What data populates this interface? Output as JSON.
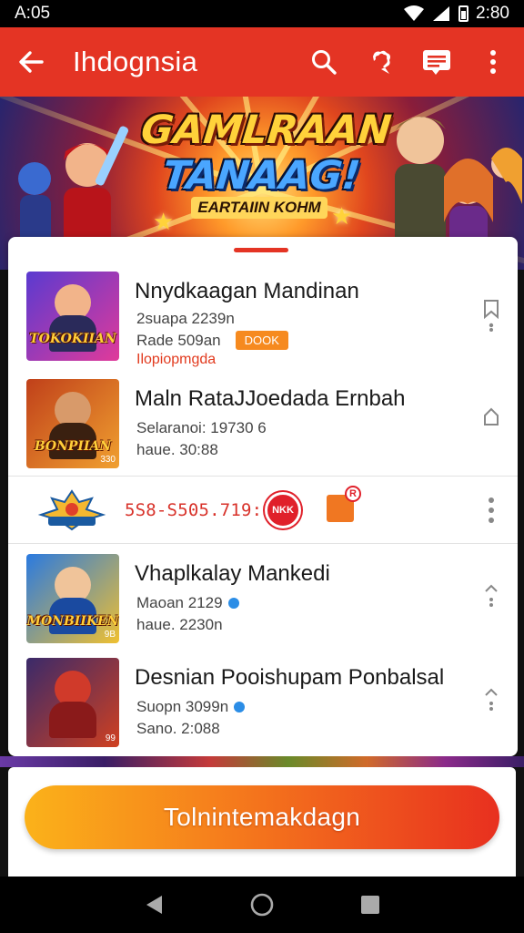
{
  "status_bar": {
    "time": "A:05",
    "clock": "2:80"
  },
  "app_bar": {
    "title": "Ihdognsia"
  },
  "banner": {
    "title_line1": "GAMLRAAN",
    "title_line2": "TANAAG!",
    "subtitle": "EARTAIIN KOHM"
  },
  "games": [
    {
      "title": "Nnydkaagan Mandinan",
      "line1": "2suapa 2239n",
      "line2": "Rade 509an",
      "badge": "DOOK",
      "link": "Ilopiopmgda",
      "thumb_label": "TOKOKIIAN",
      "thumb_colors": [
        "#5a3ad0",
        "#e03a9a"
      ]
    },
    {
      "title": "Maln RataJJoedada Ernbah",
      "line1": "Selaranoi: 19730 6",
      "line2": "haue. 30:88",
      "thumb_label": "BONPIIAN",
      "thumb_num": "330",
      "thumb_colors": [
        "#c0401a",
        "#f0a030"
      ]
    },
    {
      "title": "Vhaplkalay Mankedi",
      "line1": "Maoan 2129",
      "line2": "haue. 2230n",
      "thumb_label": "MONBIIKEN",
      "thumb_num": "9B",
      "thumb_colors": [
        "#2a7ae0",
        "#f0c030"
      ]
    },
    {
      "title": "Desnian Pooishupam Ponbalsal",
      "line1": "Suopn 3099n",
      "line2": "Sano. 2:088",
      "thumb_num": "99",
      "thumb_colors": [
        "#3a2a6a",
        "#d04020"
      ]
    }
  ],
  "promo": {
    "text": "5S8-S505.719:9n",
    "badge_text": "NKK",
    "gift_count": "R"
  },
  "cta": {
    "label": "Tolnintemakdagn"
  },
  "colors": {
    "primary": "#e43424",
    "accent_orange": "#f68a1f",
    "cta_start": "#fbb21a",
    "cta_end": "#e8301f"
  }
}
